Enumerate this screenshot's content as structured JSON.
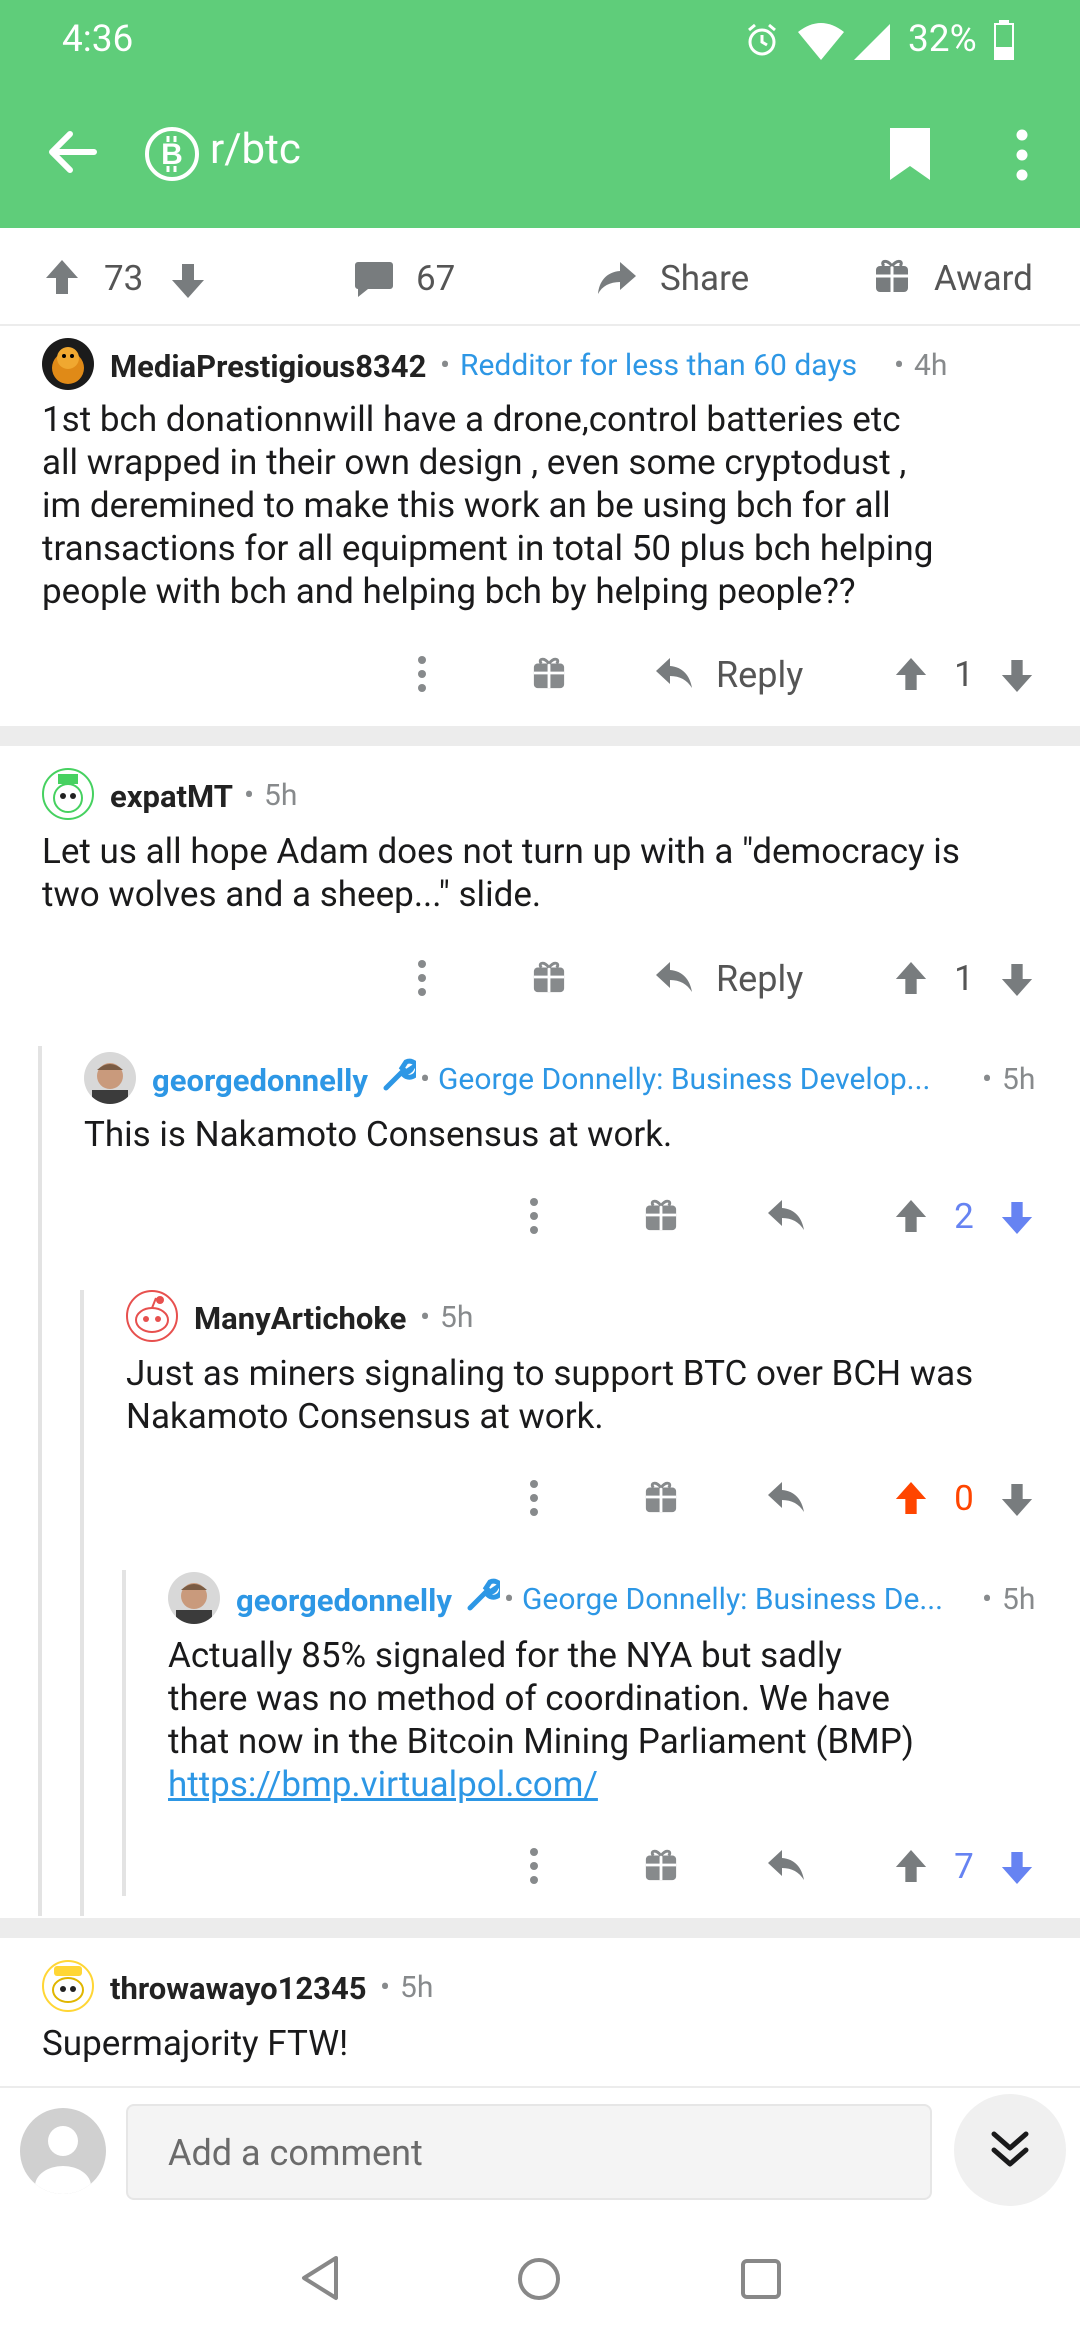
{
  "status": {
    "time": "4:36",
    "battery": "32%"
  },
  "toolbar": {
    "title": "r/btc",
    "back_icon": "arrow-left-icon",
    "bookmark_icon": "bookmark-icon",
    "more_icon": "more-vertical-icon"
  },
  "actions": {
    "upvotes": "73",
    "comments": "67",
    "share": "Share",
    "award": "Award"
  },
  "colors": {
    "header": "#5fcd7a",
    "link": "#2d97e5",
    "upvote_active": "#ff4500",
    "downvote_active": "#6683f2"
  },
  "comments": [
    {
      "author": "MediaPrestigious8342",
      "flair": "Redditor for less than 60 days",
      "time": "4h",
      "body": "1st bch donationnwill have a drone,control batteries etc\nall wrapped in their own design , even some cryptodust  ,\nim deremined to make this work an be using bch for all\ntransactions for all equipment in total 50 plus bch helping\npeople with bch and helping bch by helping people??",
      "reply": "Reply",
      "score": "1"
    },
    {
      "author": "expatMT",
      "time": "5h",
      "body": "Let us all hope Adam does not turn up with a \"democracy is\ntwo wolves and a sheep...\" slide.",
      "reply": "Reply",
      "score": "1"
    },
    {
      "author": "georgedonnelly",
      "flair": "George Donnelly: Business Develop...",
      "time": "5h",
      "body": "This is Nakamoto Consensus at work.",
      "score": "2"
    },
    {
      "author": "ManyArtichoke",
      "time": "5h",
      "body": "Just as miners signaling to support BTC over BCH was\nNakamoto Consensus at work.",
      "score": "0"
    },
    {
      "author": "georgedonnelly",
      "flair": "George Donnelly: Business De...",
      "time": "5h",
      "body": "Actually 85% signaled for the NYA but sadly\nthere was no method of coordination. We have\nthat now in the Bitcoin Mining Parliament (BMP)",
      "link": "https://bmp.virtualpol.com/",
      "score": "7"
    },
    {
      "author": "throwawayo12345",
      "time": "5h",
      "body": "Supermajority FTW!"
    }
  ],
  "comment_bar": {
    "placeholder": "Add a comment"
  }
}
